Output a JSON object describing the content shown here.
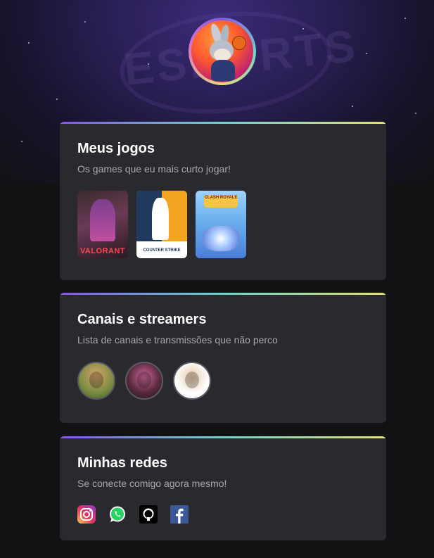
{
  "profile": {
    "avatar_alt": "Pernalonga"
  },
  "background": {
    "emblem_text": "ESPORTS"
  },
  "sections": {
    "games": {
      "title": "Meus jogos",
      "subtitle": "Os games que eu mais curto jogar!",
      "items": [
        {
          "name": "VALORANT"
        },
        {
          "name": "COUNTER STRIKE"
        },
        {
          "name": "CLASH ROYALE"
        }
      ]
    },
    "channels": {
      "title": "Canais e streamers",
      "subtitle": "Lista de canais e transmissões que não perco",
      "items": [
        {
          "name": "channel-1"
        },
        {
          "name": "channel-2"
        },
        {
          "name": "channel-3"
        }
      ]
    },
    "socials": {
      "title": "Minhas redes",
      "subtitle": "Se conecte comigo agora mesmo!",
      "items": [
        {
          "name": "instagram-icon"
        },
        {
          "name": "whatsapp-icon"
        },
        {
          "name": "github-icon"
        },
        {
          "name": "facebook-icon"
        }
      ]
    }
  },
  "colors": {
    "background": "#121214",
    "card": "#29292e",
    "accent_gradient": [
      "#8257e5",
      "#6fd3c8",
      "#e3e07a"
    ],
    "title": "#ffffff",
    "subtitle": "#a8a8b3"
  }
}
